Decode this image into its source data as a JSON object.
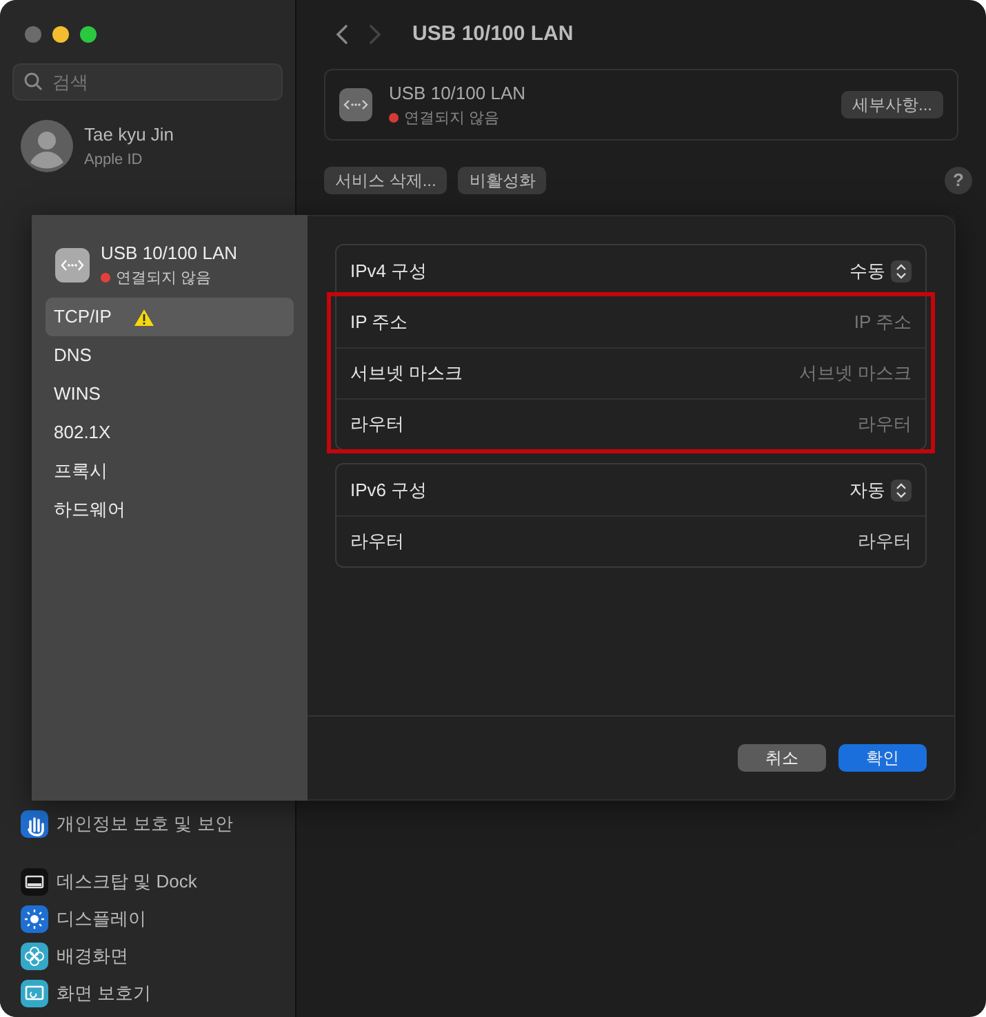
{
  "window": {
    "title": "USB 10/100 LAN",
    "back_enabled": true,
    "forward_enabled": false
  },
  "sidebar": {
    "search": {
      "placeholder": "검색"
    },
    "account": {
      "name": "Tae kyu Jin",
      "subtitle": "Apple ID"
    },
    "groups": [
      {
        "items": [
          {
            "label": "개인정보 보호 및 보안",
            "kind": "hand",
            "color": "#1f6fd1"
          }
        ]
      },
      {
        "items": [
          {
            "label": "데스크탑 및 Dock",
            "kind": "dock",
            "color": "#111111"
          },
          {
            "label": "디스플레이",
            "kind": "sun",
            "color": "#1f6fd1"
          },
          {
            "label": "배경화면",
            "kind": "flower",
            "color": "#35a8c8"
          },
          {
            "label": "화면 보호기",
            "kind": "screen",
            "color": "#35a8c8"
          }
        ]
      }
    ]
  },
  "service": {
    "name": "USB 10/100 LAN",
    "status": {
      "text": "연결되지 않음",
      "color": "#d63a35"
    },
    "details_button": "세부사항..."
  },
  "actions": [
    "서비스 삭제...",
    "비활성화"
  ],
  "help": "?",
  "sheet": {
    "name": "USB 10/100 LAN",
    "status": {
      "text": "연결되지 않음",
      "color": "#e5403a"
    },
    "nav": [
      {
        "label": "TCP/IP",
        "selected": true,
        "warning": true
      },
      {
        "label": "DNS",
        "selected": false,
        "warning": false
      },
      {
        "label": "WINS",
        "selected": false,
        "warning": false
      },
      {
        "label": "802.1X",
        "selected": false,
        "warning": false
      },
      {
        "label": "프록시",
        "selected": false,
        "warning": false
      },
      {
        "label": "하드웨어",
        "selected": false,
        "warning": false
      }
    ],
    "groups": [
      {
        "rows": [
          {
            "kind": "select",
            "label": "IPv4 구성",
            "value": "수동",
            "highlighted": false
          },
          {
            "kind": "field",
            "label": "IP 주소",
            "placeholder": "IP 주소",
            "highlighted": true
          },
          {
            "kind": "field",
            "label": "서브넷 마스크",
            "placeholder": "서브넷 마스크",
            "highlighted": true
          },
          {
            "kind": "field",
            "label": "라우터",
            "placeholder": "라우터",
            "highlighted": true
          }
        ]
      },
      {
        "rows": [
          {
            "kind": "select",
            "label": "IPv6 구성",
            "value": "자동",
            "highlighted": false
          },
          {
            "kind": "text",
            "label": "라우터",
            "value": "라우터",
            "highlighted": false
          }
        ]
      }
    ],
    "buttons": [
      {
        "label": "취소",
        "kind": "secondary"
      },
      {
        "label": "확인",
        "kind": "primary"
      }
    ]
  }
}
